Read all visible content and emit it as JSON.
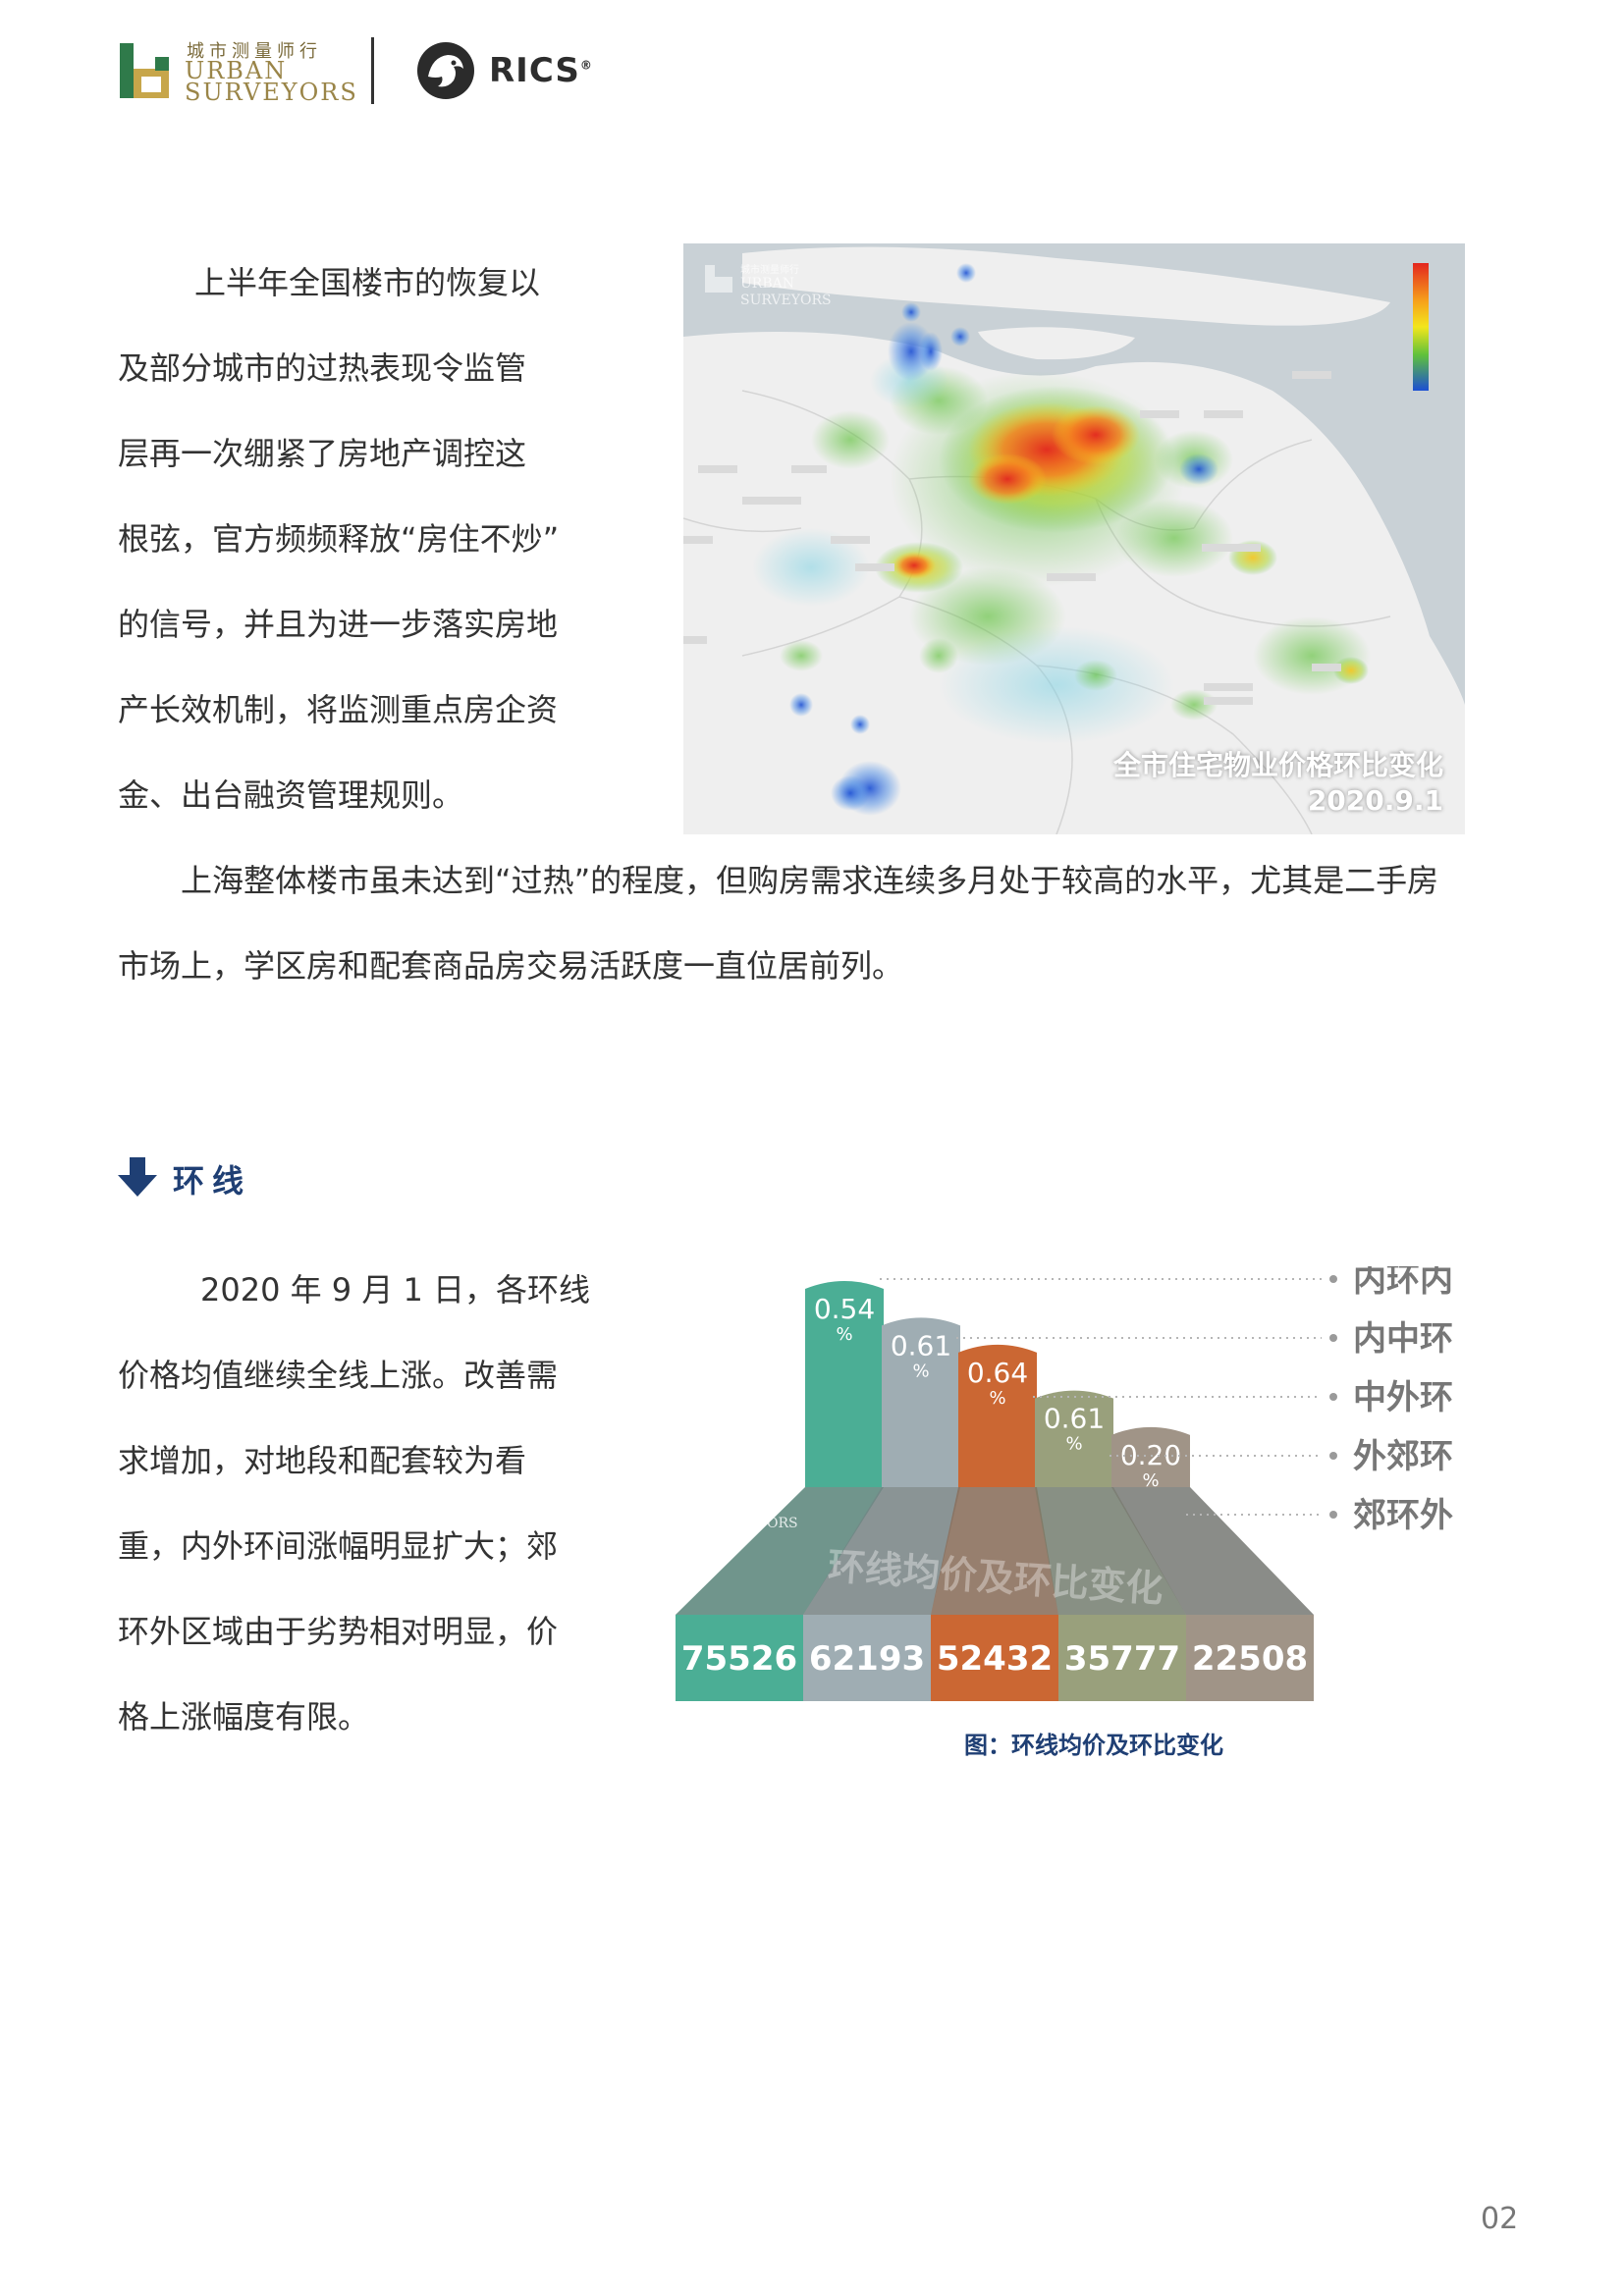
{
  "header": {
    "brand_cn": "城市测量师行",
    "brand_en_line1": "URBAN",
    "brand_en_line2": "SURVEYORS",
    "partner": "RICS",
    "partner_mark": "®"
  },
  "intro": {
    "lines": [
      "上半年全国楼市的恢复以",
      "及部分城市的过热表现令监管",
      "层再一次绷紧了房地产调控这",
      "根弦，官方频频释放“房住不炒”",
      "的信号，并且为进一步落实房地",
      "产长效机制，将监测重点房企资",
      "金、出台融资管理规则。"
    ],
    "full_lines": [
      "上海整体楼市虽未达到“过热”的程度，但购房需求连续多月处于较高的水平，尤其是二手房",
      "市场上，学区房和配套商品房交易活跃度一直位居前列。"
    ]
  },
  "map": {
    "title": "全市住宅物业价格环比变化",
    "date": "2020.9.1",
    "watermark_cn": "城市测量师行",
    "watermark_en1": "URBAN",
    "watermark_en2": "SURVEYORS",
    "legend_colors": [
      "#e3261f",
      "#f6a21b",
      "#f3e61c",
      "#5fc13b",
      "#1c4fd3"
    ],
    "water_color": "#c9d1d6",
    "land_color": "#efefef"
  },
  "section": {
    "icon": "arrow-down-icon",
    "title": "环线"
  },
  "ring_text": {
    "lines": [
      "2020 年 9 月 1 日，各环线",
      "价格均值继续全线上涨。改善需",
      "求增加，对地段和配套较为看",
      "重，内外环间涨幅明显扩大；郊",
      "环外区域由于劣势相对明显，价",
      "格上涨幅度有限。"
    ]
  },
  "chart_data": {
    "type": "bar",
    "title": "环线均价及环比变化",
    "categories": [
      "内环内",
      "内中环",
      "中外环",
      "外郊环",
      "郊环外"
    ],
    "series": [
      {
        "values": [
          75526,
          62193,
          52432,
          35777,
          22508
        ]
      },
      {
        "values": [
          0.54,
          0.61,
          0.64,
          0.61,
          0.2
        ]
      }
    ],
    "value_labels": [
      "75526",
      "62193",
      "52432",
      "35777",
      "22508"
    ],
    "change_labels": [
      "0.54",
      "0.61",
      "0.64",
      "0.61",
      "0.20"
    ],
    "change_unit": "%",
    "colors": [
      "#4bae95",
      "#9fadb3",
      "#cb6733",
      "#99a07c",
      "#a09487"
    ],
    "caption": "图：环线均价及环比变化",
    "watermark_cn": "城市测量师行",
    "watermark_en1": "URBAN",
    "watermark_en2": "SURVEYORS"
  },
  "footer": {
    "page_number": "02"
  }
}
